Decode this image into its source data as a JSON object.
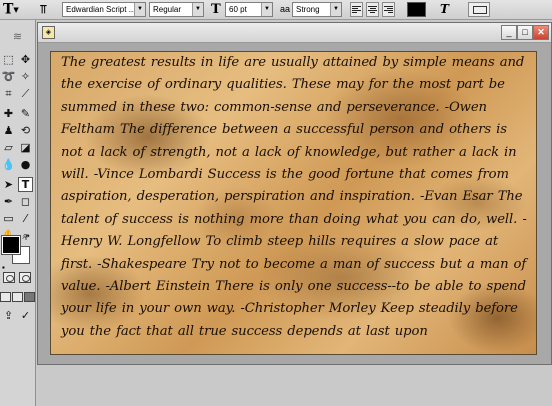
{
  "options_bar": {
    "tool_preset_glyph": "T",
    "orientation_glyph": "⫪",
    "font_family": "Edwardian Script ...",
    "font_style": "Regular",
    "size_icon_glyph": "T",
    "font_size": "60 pt",
    "aa_icon": "aa",
    "anti_alias": "Strong",
    "text_color": "#000000"
  },
  "toolbox": {
    "foreground_color": "#000000",
    "background_color": "#ffffff"
  },
  "document": {
    "icon": "document-icon",
    "canvas_text": "The greatest results in life are usually attained by simple means and the exercise of ordinary qualities. These may for the most part be summed in these two: common-sense and perseverance. -Owen Feltham The difference between a successful person and others is not a lack of strength, not a lack of knowledge, but rather a lack in will. -Vince Lombardi Success is the good fortune that comes from aspiration, desperation, perspiration and inspiration. -Evan Esar The talent of success is nothing more than doing what you can do, well. -Henry W. Longfellow To climb steep hills requires a slow pace at first. -Shakespeare Try not to become a man of success but a man of value. -Albert Einstein There is only one success--to be able to spend your life in your own way. -Christopher Morley Keep steadily before you the fact that all true success depends at last upon"
  }
}
